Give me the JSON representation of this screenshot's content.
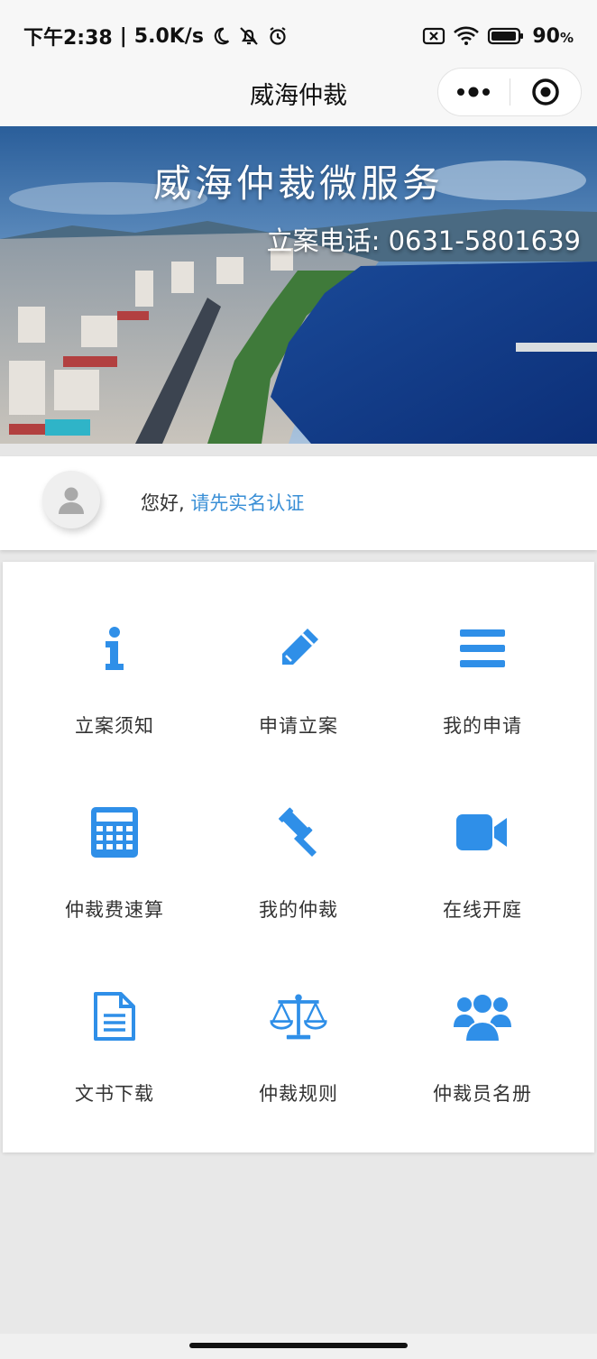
{
  "status_bar": {
    "time": "下午2:38",
    "network_speed": "5.0K/s",
    "battery": "90",
    "battery_unit": "%",
    "icons": [
      "moon-icon",
      "bell-off-icon",
      "alarm-icon",
      "sim-off-icon",
      "wifi-icon",
      "battery-icon"
    ]
  },
  "nav": {
    "title": "威海仲裁",
    "more_icon": "more-dots-icon",
    "close_icon": "target-circle-icon"
  },
  "banner": {
    "title": "威海仲裁微服务",
    "phone_label": "立案电话",
    "phone_separator": ":",
    "phone_number": "0631-5801639"
  },
  "user": {
    "greeting": "您好,",
    "verify_link": "请先实名认证",
    "avatar_icon": "user-silhouette-icon"
  },
  "menu": {
    "accent_color": "#2f8fe8",
    "items": [
      {
        "label": "立案须知",
        "icon": "info-icon"
      },
      {
        "label": "申请立案",
        "icon": "pencil-icon"
      },
      {
        "label": "我的申请",
        "icon": "list-icon"
      },
      {
        "label": "仲裁费速算",
        "icon": "calculator-icon"
      },
      {
        "label": "我的仲裁",
        "icon": "gavel-icon"
      },
      {
        "label": "在线开庭",
        "icon": "video-camera-icon"
      },
      {
        "label": "文书下载",
        "icon": "document-icon"
      },
      {
        "label": "仲裁规则",
        "icon": "scales-icon"
      },
      {
        "label": "仲裁员名册",
        "icon": "users-icon"
      }
    ]
  }
}
